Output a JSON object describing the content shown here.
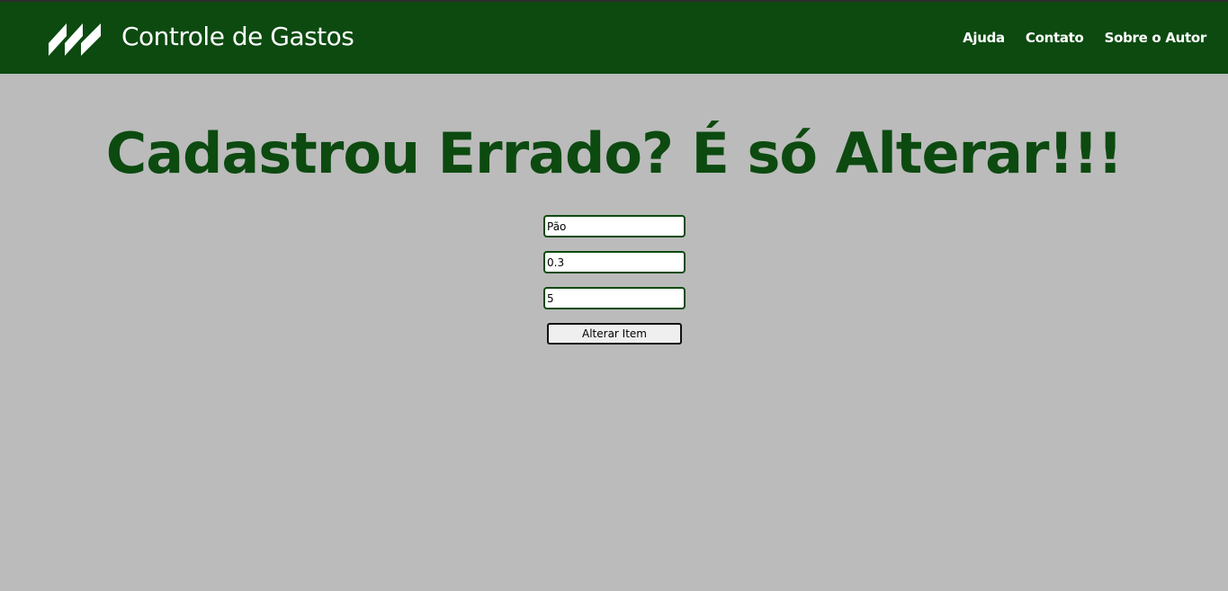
{
  "header": {
    "brand_title": "Controle de Gastos",
    "logo_icon": "diagonal-stripes-logo",
    "nav": [
      {
        "label": "Ajuda"
      },
      {
        "label": "Contato"
      },
      {
        "label": "Sobre o Autor"
      }
    ]
  },
  "main": {
    "headline": "Cadastrou Errado? É só Alterar!!!",
    "form": {
      "item_name_value": "Pão",
      "item_price_value": "0.3",
      "item_quantity_value": "5",
      "submit_label": "Alterar Item"
    }
  },
  "colors": {
    "header_bg": "#0c4a10",
    "page_bg": "#bbbbbb",
    "accent": "#0c4a10"
  }
}
